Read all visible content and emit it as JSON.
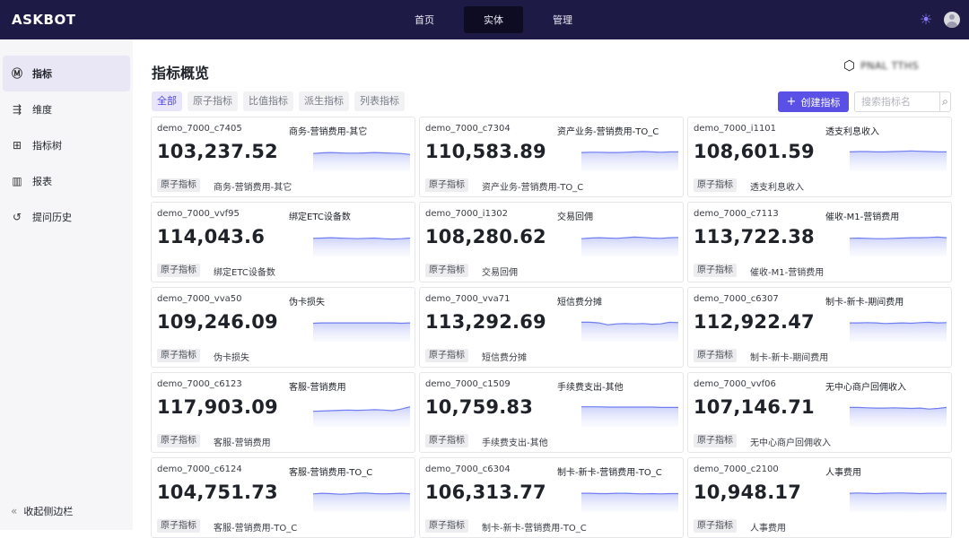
{
  "app": {
    "logo": "ASKBOT"
  },
  "nav": {
    "items": [
      "首页",
      "实体",
      "管理"
    ],
    "active": 1
  },
  "sidebar": {
    "items": [
      {
        "label": "指标",
        "icon": "metric-icon"
      },
      {
        "label": "维度",
        "icon": "dimension-icon"
      },
      {
        "label": "指标树",
        "icon": "tree-icon"
      },
      {
        "label": "报表",
        "icon": "report-icon"
      },
      {
        "label": "提问历史",
        "icon": "history-icon"
      }
    ],
    "collapse_label": "收起侧边栏"
  },
  "main": {
    "title": "指标概览",
    "project_name": "PNAL TTHS"
  },
  "filters": [
    "全部",
    "原子指标",
    "比值指标",
    "派生指标",
    "列表指标"
  ],
  "toolbar": {
    "create_label": "创建指标",
    "search_placeholder": "搜索指标名"
  },
  "colors": {
    "accent": "#5b50e6",
    "topbar": "#1d1b45",
    "spark_line": "#6f7ef0",
    "spark_fill": "#dfe4fb"
  },
  "cards": [
    {
      "code": "demo_7000_c7405",
      "name": "商务-营销费用-其它",
      "value": "103,237.52",
      "tag": "原子指标",
      "desc": "商务-营销费用-其它",
      "trend": [
        0.55,
        0.57,
        0.58,
        0.57,
        0.56,
        0.56,
        0.57,
        0.58,
        0.57,
        0.56,
        0.55,
        0.52
      ]
    },
    {
      "code": "demo_7000_c7304",
      "name": "资产业务-营销费用-TO_C",
      "value": "110,583.89",
      "tag": "原子指标",
      "desc": "资产业务-营销费用-TO_C",
      "trend": [
        0.58,
        0.59,
        0.59,
        0.58,
        0.58,
        0.59,
        0.6,
        0.61,
        0.6,
        0.59,
        0.6,
        0.6
      ]
    },
    {
      "code": "demo_7000_i1101",
      "name": "透支利息收入",
      "value": "108,601.59",
      "tag": "原子指标",
      "desc": "透支利息收入",
      "trend": [
        0.6,
        0.61,
        0.61,
        0.6,
        0.6,
        0.61,
        0.62,
        0.63,
        0.62,
        0.61,
        0.6,
        0.6
      ]
    },
    {
      "code": "demo_7000_vvf95",
      "name": "绑定ETC设备数",
      "value": "114,043.6",
      "tag": "原子指标",
      "desc": "绑定ETC设备数",
      "trend": [
        0.56,
        0.57,
        0.58,
        0.57,
        0.56,
        0.55,
        0.56,
        0.57,
        0.55,
        0.54,
        0.55,
        0.57
      ]
    },
    {
      "code": "demo_7000_i1302",
      "name": "交易回佣",
      "value": "108,280.62",
      "tag": "原子指标",
      "desc": "交易回佣",
      "trend": [
        0.55,
        0.57,
        0.58,
        0.57,
        0.56,
        0.58,
        0.6,
        0.59,
        0.57,
        0.56,
        0.58,
        0.59
      ]
    },
    {
      "code": "demo_7000_c7113",
      "name": "催收-M1-营销费用",
      "value": "113,722.38",
      "tag": "原子指标",
      "desc": "催收-M1-营销费用",
      "trend": [
        0.56,
        0.57,
        0.56,
        0.55,
        0.55,
        0.56,
        0.57,
        0.58,
        0.58,
        0.59,
        0.6,
        0.58
      ]
    },
    {
      "code": "demo_7000_vva50",
      "name": "伪卡损失",
      "value": "109,246.09",
      "tag": "原子指标",
      "desc": "伪卡损失",
      "trend": [
        0.57,
        0.58,
        0.58,
        0.58,
        0.58,
        0.58,
        0.58,
        0.58,
        0.58,
        0.58,
        0.57,
        0.58
      ]
    },
    {
      "code": "demo_7000_vva71",
      "name": "短信费分摊",
      "value": "113,292.69",
      "tag": "原子指标",
      "desc": "短信费分摊",
      "trend": [
        0.6,
        0.6,
        0.58,
        0.52,
        0.55,
        0.56,
        0.55,
        0.56,
        0.54,
        0.55,
        0.6,
        0.59
      ]
    },
    {
      "code": "demo_7000_c6307",
      "name": "制卡-新卡-期间费用",
      "value": "112,922.47",
      "tag": "原子指标",
      "desc": "制卡-新卡-期间费用",
      "trend": [
        0.58,
        0.58,
        0.59,
        0.58,
        0.56,
        0.57,
        0.58,
        0.57,
        0.59,
        0.6,
        0.58,
        0.59
      ]
    },
    {
      "code": "demo_7000_c6123",
      "name": "客服-营销费用",
      "value": "117,903.09",
      "tag": "原子指标",
      "desc": "客服-营销费用",
      "trend": [
        0.48,
        0.49,
        0.5,
        0.51,
        0.52,
        0.51,
        0.52,
        0.53,
        0.52,
        0.5,
        0.55,
        0.62
      ]
    },
    {
      "code": "demo_7000_c1509",
      "name": "手续费支出-其他",
      "value": "10,759.83",
      "tag": "原子指标",
      "desc": "手续费支出-其他",
      "trend": [
        0.62,
        0.62,
        0.62,
        0.61,
        0.61,
        0.61,
        0.61,
        0.61,
        0.61,
        0.6,
        0.6,
        0.6
      ]
    },
    {
      "code": "demo_7000_vvf06",
      "name": "无中心商户回佣收入",
      "value": "107,146.71",
      "tag": "原子指标",
      "desc": "无中心商户回佣收入",
      "trend": [
        0.6,
        0.6,
        0.59,
        0.58,
        0.58,
        0.59,
        0.58,
        0.57,
        0.58,
        0.55,
        0.57,
        0.6
      ]
    },
    {
      "code": "demo_7000_c6124",
      "name": "客服-营销费用-TO_C",
      "value": "104,751.73",
      "tag": "原子指标",
      "desc": "客服-营销费用-TO_C",
      "trend": [
        0.56,
        0.58,
        0.57,
        0.55,
        0.56,
        0.58,
        0.59,
        0.57,
        0.56,
        0.57,
        0.58,
        0.56
      ]
    },
    {
      "code": "demo_7000_c6304",
      "name": "制卡-新卡-营销费用-TO_C",
      "value": "106,313.77",
      "tag": "原子指标",
      "desc": "制卡-新卡-营销费用-TO_C",
      "trend": [
        0.58,
        0.58,
        0.57,
        0.57,
        0.58,
        0.58,
        0.57,
        0.56,
        0.57,
        0.56,
        0.57,
        0.57
      ]
    },
    {
      "code": "demo_7000_c2100",
      "name": "人事费用",
      "value": "10,948.17",
      "tag": "原子指标",
      "desc": "人事费用",
      "trend": [
        0.58,
        0.59,
        0.58,
        0.57,
        0.58,
        0.59,
        0.59,
        0.58,
        0.57,
        0.58,
        0.58,
        0.58
      ]
    }
  ]
}
